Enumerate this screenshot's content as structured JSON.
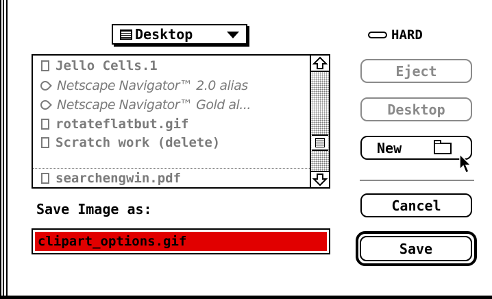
{
  "dialog": {
    "folder_popup": {
      "label": "Desktop",
      "icon": "desktop-icon"
    },
    "drive": {
      "label": "HARD",
      "icon": "hard-disk-icon"
    },
    "file_list": {
      "items": [
        {
          "name": "Jello Cells.1",
          "kind": "file"
        },
        {
          "name": "Netscape Navigator™ 2.0 alias",
          "kind": "alias"
        },
        {
          "name": "Netscape Navigator™ Gold al...",
          "kind": "alias"
        },
        {
          "name": "rotateflatbut.gif",
          "kind": "file"
        },
        {
          "name": "Scratch work (delete)",
          "kind": "file"
        },
        {
          "name": "searchengwin.pdf",
          "kind": "file"
        }
      ]
    },
    "save_as_label": "Save Image as:",
    "filename_value": "clipart_options.gif",
    "buttons": {
      "eject": "Eject",
      "desktop": "Desktop",
      "new": "New",
      "cancel": "Cancel",
      "save": "Save"
    },
    "colors": {
      "selection": "#e10000",
      "dimmed": "#7b7b7b"
    }
  }
}
